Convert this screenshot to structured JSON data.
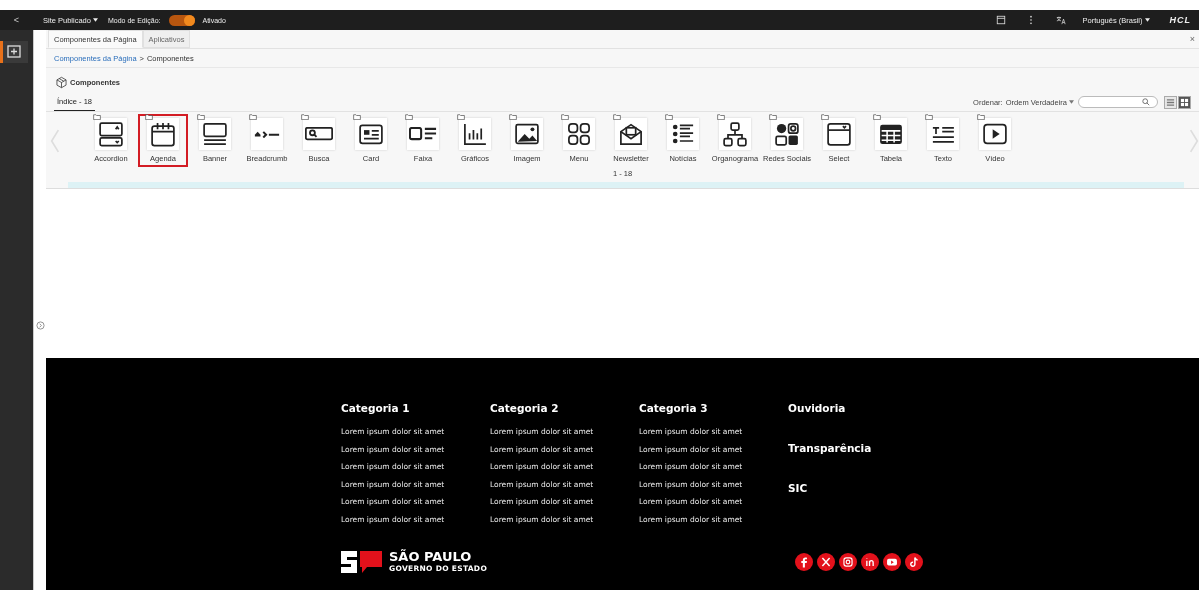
{
  "top_bar": {
    "back": "<",
    "site_menu": "Site Publicado",
    "edit_mode": {
      "label": "Modo de Edição:",
      "on": true,
      "state_label": "Ativado"
    },
    "language": "Português (Brasil)",
    "logo": "HCL"
  },
  "panel": {
    "tabs": [
      {
        "label": "Componentes da Página",
        "selected": true
      },
      {
        "label": "Aplicativos",
        "selected": false
      }
    ],
    "close": "×",
    "breadcrumb": {
      "link": "Componentes da Página",
      "separator": ">",
      "current": "Componentes"
    },
    "heading": "Componentes",
    "index_tab": "Índice - 18",
    "sort": {
      "label": "Ordenar:",
      "value": "Ordem Verdadeira"
    },
    "view": [
      {
        "kind": "list",
        "selected": false
      },
      {
        "kind": "grid",
        "selected": true
      }
    ],
    "components": [
      {
        "label": "Accordion",
        "selected": false
      },
      {
        "label": "Agenda",
        "selected": true
      },
      {
        "label": "Banner",
        "selected": false
      },
      {
        "label": "Breadcrumb",
        "selected": false
      },
      {
        "label": "Busca",
        "selected": false
      },
      {
        "label": "Card",
        "selected": false
      },
      {
        "label": "Faixa",
        "selected": false
      },
      {
        "label": "Gráficos",
        "selected": false
      },
      {
        "label": "Imagem",
        "selected": false
      },
      {
        "label": "Menu",
        "selected": false
      },
      {
        "label": "Newsletter",
        "selected": false
      },
      {
        "label": "Notícias",
        "selected": false
      },
      {
        "label": "Organograma",
        "selected": false
      },
      {
        "label": "Redes Sociais",
        "selected": false
      },
      {
        "label": "Select",
        "selected": false
      },
      {
        "label": "Tabela",
        "selected": false
      },
      {
        "label": "Texto",
        "selected": false
      },
      {
        "label": "Vídeo",
        "selected": false
      }
    ],
    "pagination": "1 - 18"
  },
  "footer": {
    "columns": [
      {
        "title": "Categoria 1",
        "links": [
          "Lorem ipsum dolor sit amet",
          "Lorem ipsum dolor sit amet",
          "Lorem ipsum dolor sit amet",
          "Lorem ipsum dolor sit amet",
          "Lorem ipsum dolor sit amet",
          "Lorem ipsum dolor sit amet"
        ]
      },
      {
        "title": "Categoria 2",
        "links": [
          "Lorem ipsum dolor sit amet",
          "Lorem ipsum dolor sit amet",
          "Lorem ipsum dolor sit amet",
          "Lorem ipsum dolor sit amet",
          "Lorem ipsum dolor sit amet",
          "Lorem ipsum dolor sit amet"
        ]
      },
      {
        "title": "Categoria 3",
        "links": [
          "Lorem ipsum dolor sit amet",
          "Lorem ipsum dolor sit amet",
          "Lorem ipsum dolor sit amet",
          "Lorem ipsum dolor sit amet",
          "Lorem ipsum dolor sit amet",
          "Lorem ipsum dolor sit amet"
        ]
      }
    ],
    "side_links": [
      "Ouvidoria",
      "Transparência",
      "SIC"
    ],
    "logo": {
      "title": "SÃO PAULO",
      "subtitle": "GOVERNO DO ESTADO"
    }
  }
}
